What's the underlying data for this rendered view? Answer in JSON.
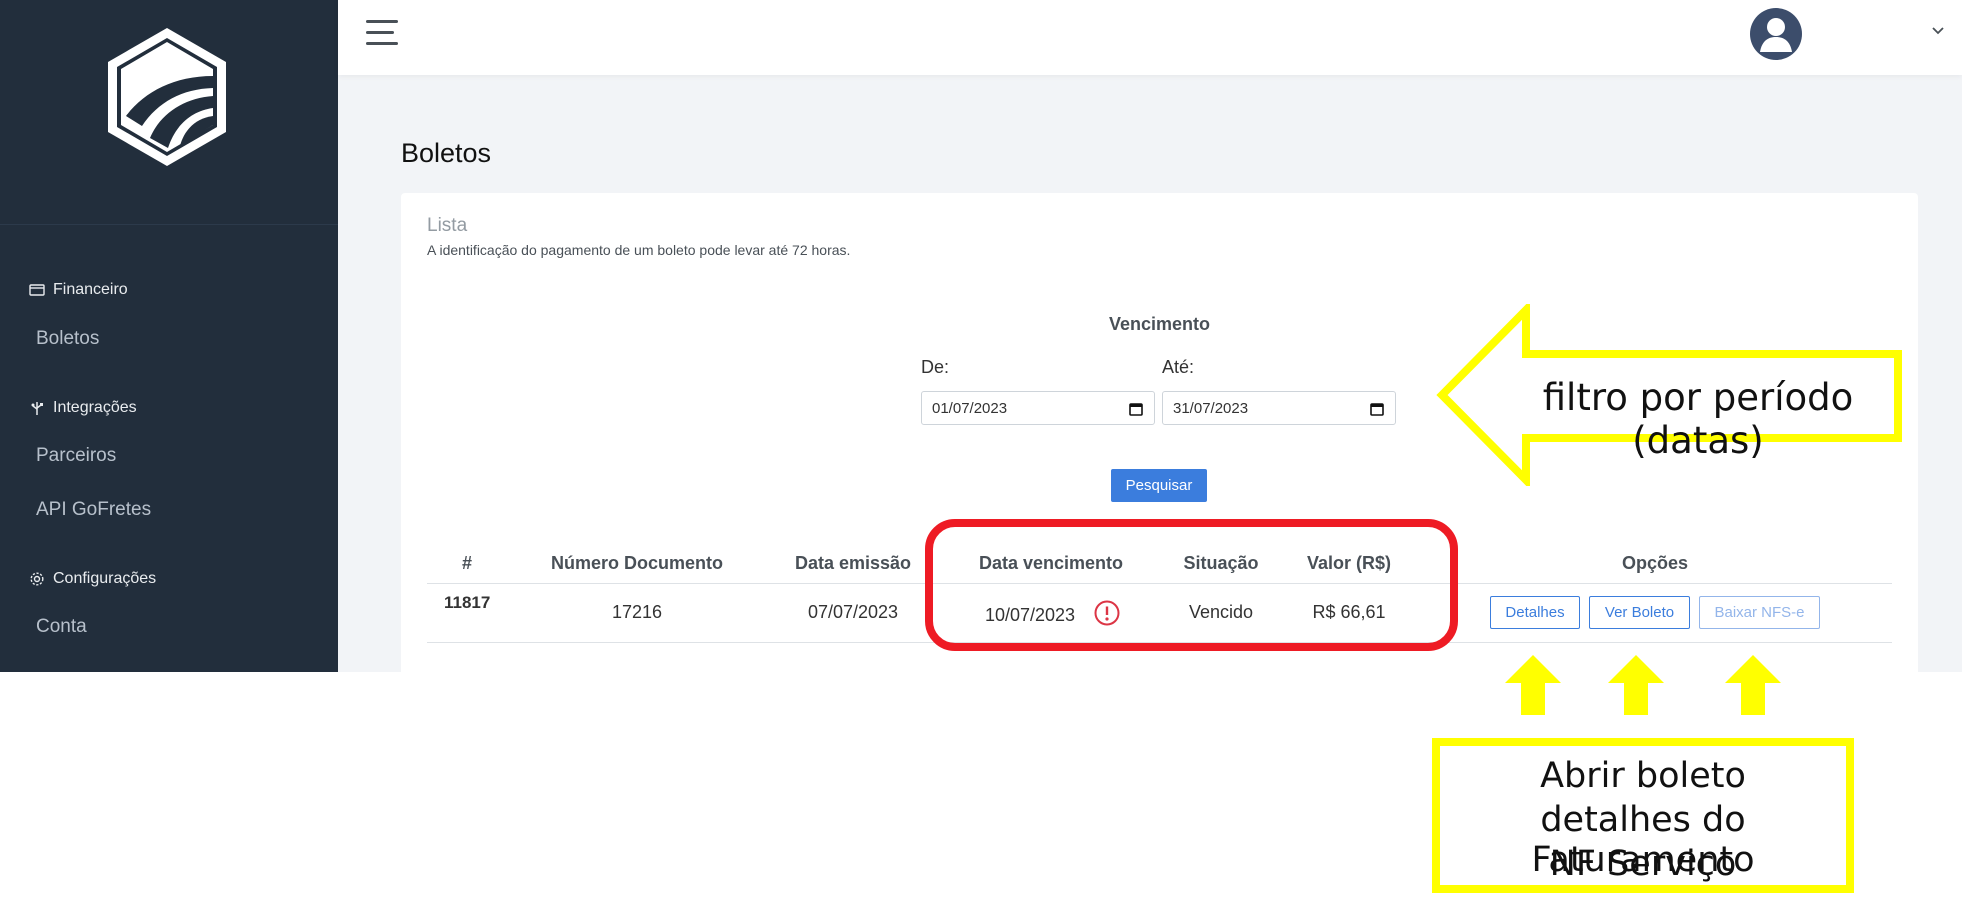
{
  "sidebar": {
    "sections": [
      {
        "header": "Financeiro",
        "icon": "wallet-icon",
        "items": [
          "Boletos"
        ]
      },
      {
        "header": "Integrações",
        "icon": "usb-icon",
        "items": [
          "Parceiros",
          "API GoFretes"
        ]
      },
      {
        "header": "Configurações",
        "icon": "gear-icon",
        "items": [
          "Conta"
        ]
      }
    ]
  },
  "page": {
    "title": "Boletos"
  },
  "card": {
    "title": "Lista",
    "subtitle": "A identificação do pagamento de um boleto pode levar até 72 horas."
  },
  "filter": {
    "title": "Vencimento",
    "from_label": "De:",
    "from_value": "01/07/2023",
    "to_label": "Até:",
    "to_value": "31/07/2023",
    "search_label": "Pesquisar"
  },
  "table": {
    "headers": [
      "#",
      "Número Documento",
      "Data emissão",
      "Data vencimento",
      "Situação",
      "Valor (R$)",
      "Opções"
    ],
    "rows": [
      {
        "id": "11817",
        "numero": "17216",
        "emissao": "07/07/2023",
        "vencimento": "10/07/2023",
        "situacao": "Vencido",
        "valor": "R$ 66,61",
        "options": [
          "Detalhes",
          "Ver Boleto",
          "Baixar NFS-e"
        ]
      }
    ]
  },
  "annotations": {
    "filter_note": "filtro por período (datas)",
    "options_note": [
      "Abrir boleto",
      "detalhes do Faturamento",
      "NF Serviço"
    ]
  },
  "colors": {
    "sidebar_bg": "#222e3c",
    "primary": "#3b7ddd",
    "annotation_red": "#ee1b24",
    "annotation_yellow": "#ffff00"
  }
}
